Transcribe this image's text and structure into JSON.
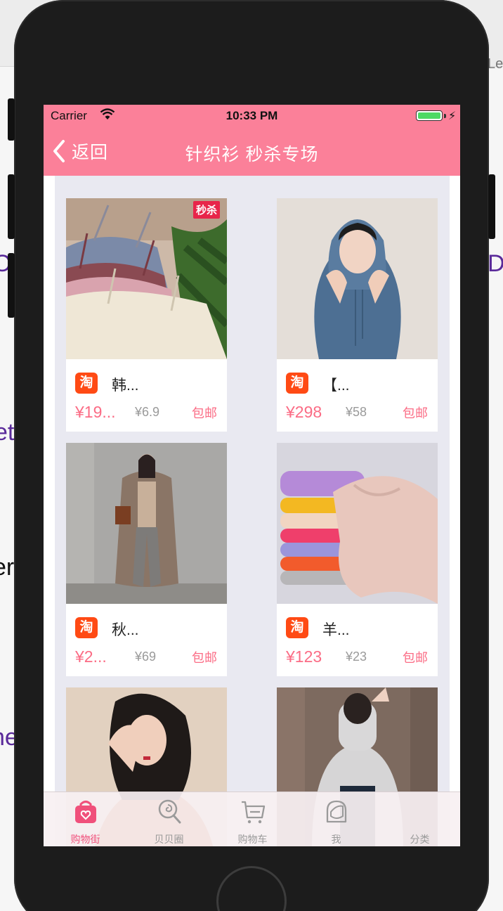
{
  "background": {
    "fragments": [
      "Le",
      "O",
      "D",
      "et",
      "er",
      "ne"
    ]
  },
  "status_bar": {
    "carrier": "Carrier",
    "time": "10:33 PM"
  },
  "nav": {
    "back_label": "返回",
    "title": "针织衫 秒杀专场"
  },
  "products": [
    {
      "badge": "秒杀",
      "shop_icon": "淘",
      "title": "韩...",
      "price": "¥19...",
      "original_price": "¥6.9",
      "shipping": "包邮"
    },
    {
      "badge": "",
      "shop_icon": "淘",
      "title": "【...",
      "price": "¥298",
      "original_price": "¥58",
      "shipping": "包邮"
    },
    {
      "badge": "",
      "shop_icon": "淘",
      "title": "秋...",
      "price": "¥2...",
      "original_price": "¥69",
      "shipping": "包邮"
    },
    {
      "badge": "",
      "shop_icon": "淘",
      "title": "羊...",
      "price": "¥123",
      "original_price": "¥23",
      "shipping": "包邮"
    },
    {
      "badge": "",
      "shop_icon": "",
      "title": "",
      "price": "",
      "original_price": "",
      "shipping": ""
    },
    {
      "badge": "",
      "shop_icon": "",
      "title": "",
      "price": "",
      "original_price": "",
      "shipping": ""
    }
  ],
  "tabbar": {
    "items": [
      {
        "label": "购物街",
        "icon": "shopping-bag-icon",
        "active": true
      },
      {
        "label": "贝贝圈",
        "icon": "lollipop-icon",
        "active": false
      },
      {
        "label": "购物车",
        "icon": "cart-icon",
        "active": false
      },
      {
        "label": "我",
        "icon": "profile-icon",
        "active": false
      },
      {
        "label": "分类",
        "icon": "category-icon",
        "active": false
      }
    ]
  },
  "colors": {
    "nav_background": "#fb8099",
    "accent": "#fb6c85",
    "tab_active": "#f0507b",
    "taobao": "#ff4a14"
  }
}
